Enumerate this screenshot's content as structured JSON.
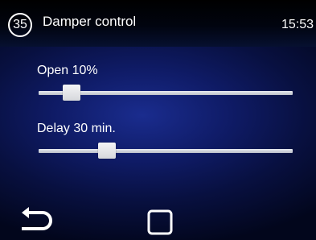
{
  "header": {
    "screen_number": "35",
    "title": "Damper control",
    "clock": "15:53"
  },
  "sliders": [
    {
      "label": "Open 10%",
      "value": 0.13
    },
    {
      "label": "Delay 30 min.",
      "value": 0.27
    }
  ],
  "footer": {
    "back_icon": "return-arrow-icon",
    "home_icon": "square-home-icon"
  },
  "colors": {
    "background": "#0f1b66",
    "text": "#ffffff",
    "track": "#c8ccd4",
    "thumb": "#e8e9ec"
  }
}
